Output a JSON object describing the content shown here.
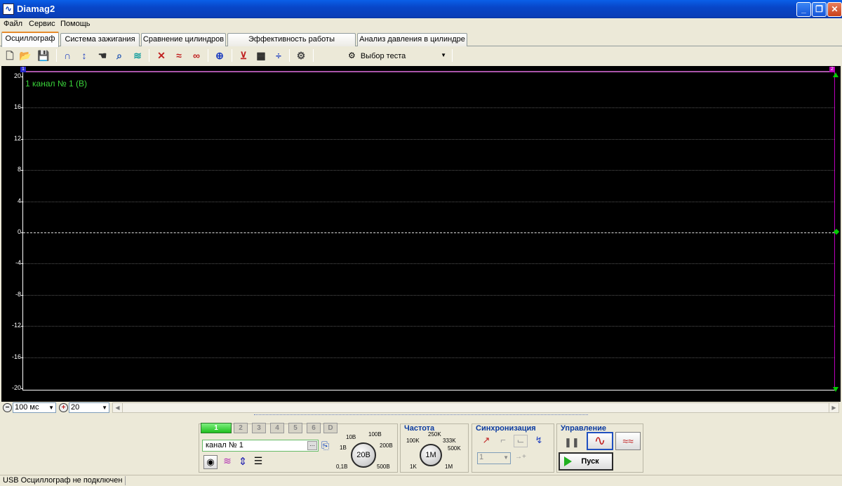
{
  "window": {
    "title": "Diamag2"
  },
  "menu": [
    "Файл",
    "Сервис",
    "Помощь"
  ],
  "tabs": [
    {
      "label": "Осциллограф",
      "active": true
    },
    {
      "label": "Система зажигания"
    },
    {
      "label": "Сравнение цилиндров"
    },
    {
      "label": "Эффективность работы цилиндров"
    },
    {
      "label": "Анализ давления в цилиндре"
    }
  ],
  "toolbar": {
    "test_select": "Выбор теста"
  },
  "scope": {
    "channel_label": "1  канал № 1 (В)",
    "y_ticks": [
      "20",
      "16",
      "12",
      "8",
      "4",
      "0",
      "-4",
      "-8",
      "-12",
      "-16",
      "-20"
    ],
    "top_marker_left": "1",
    "top_marker_right": "2",
    "colors": {
      "background": "#000000",
      "trace_label": "#3ad43a",
      "markers": "#00cc00"
    }
  },
  "zoom": {
    "time_scale": "100 мс",
    "amp_scale": "20"
  },
  "panel": {
    "channels": [
      "1",
      "2",
      "3",
      "4",
      "5",
      "6",
      "D"
    ],
    "channel_name": "канал № 1",
    "volt_knob": {
      "value": "20В",
      "labels": [
        "10В",
        "100В",
        "1В",
        "200В",
        "0,1В",
        "500В"
      ]
    },
    "freq_group": {
      "title": "Частота",
      "value": "1М",
      "labels": [
        "250K",
        "100K",
        "333K",
        "500K",
        "1K",
        "1M"
      ]
    },
    "sync_group": {
      "title": "Синхронизация",
      "channel": "1"
    },
    "control_group": {
      "title": "Управление",
      "start_label": "Пуск"
    }
  },
  "status": {
    "text": "USB Осциллограф не подключен"
  }
}
